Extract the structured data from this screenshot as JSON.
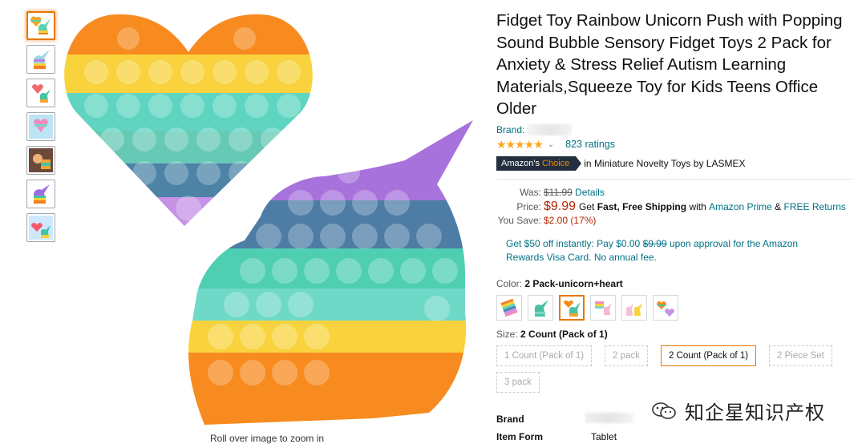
{
  "product": {
    "title": "Fidget Toy Rainbow Unicorn Push with Popping Sound Bubble Sensory Fidget Toys 2 Pack for Anxiety & Stress Relief Autism Learning Materials,Squeeze Toy for Kids Teens Office Older",
    "brand_label": "Brand: ",
    "stars": "★★★★★",
    "ratings": "823 ratings",
    "badge_prefix": "Amazon's",
    "badge_suffix": "Choice",
    "badge_context": "in Miniature Novelty Toys by LASMEX"
  },
  "pricing": {
    "was_label": "Was:",
    "was_price": "$11.99",
    "details": "Details",
    "price_label": "Price:",
    "price": "$9.99",
    "get": "Get",
    "fast_shipping": "Fast, Free Shipping",
    "with": "with",
    "prime": "Amazon Prime",
    "amp": "&",
    "free_returns": "FREE Returns",
    "save_label": "You Save:",
    "save_value": "$2.00 (17%)"
  },
  "offer": {
    "line1_a": "Get $50 off instantly: Pay $0.00",
    "line1_strike": "$9.99",
    "line1_b": "upon approval for the Amazon",
    "line2": "Rewards Visa Card. No annual fee."
  },
  "color": {
    "label": "Color:",
    "selected": "2 Pack-unicorn+heart",
    "swatch_icons": [
      "rainbow-square-icon",
      "unicorn-teal-icon",
      "unicorn-heart-icon",
      "stripes-icon",
      "unicorn-pair-icon",
      "heart-pair-icon"
    ]
  },
  "size": {
    "label": "Size:",
    "selected": "2 Count (Pack of 1)",
    "options": [
      "1 Count (Pack of 1)",
      "2 pack",
      "2 Count (Pack of 1)",
      "2 Piece Set",
      "3 pack"
    ]
  },
  "specs": {
    "brand_label": "Brand",
    "form_label": "Item Form",
    "form_value": "Tablet"
  },
  "zoom_hint": "Roll over image to zoom in",
  "watermark": "知企星知识产权",
  "colors": {
    "accent": "#e77600",
    "link": "#007185",
    "price": "#b12704"
  }
}
